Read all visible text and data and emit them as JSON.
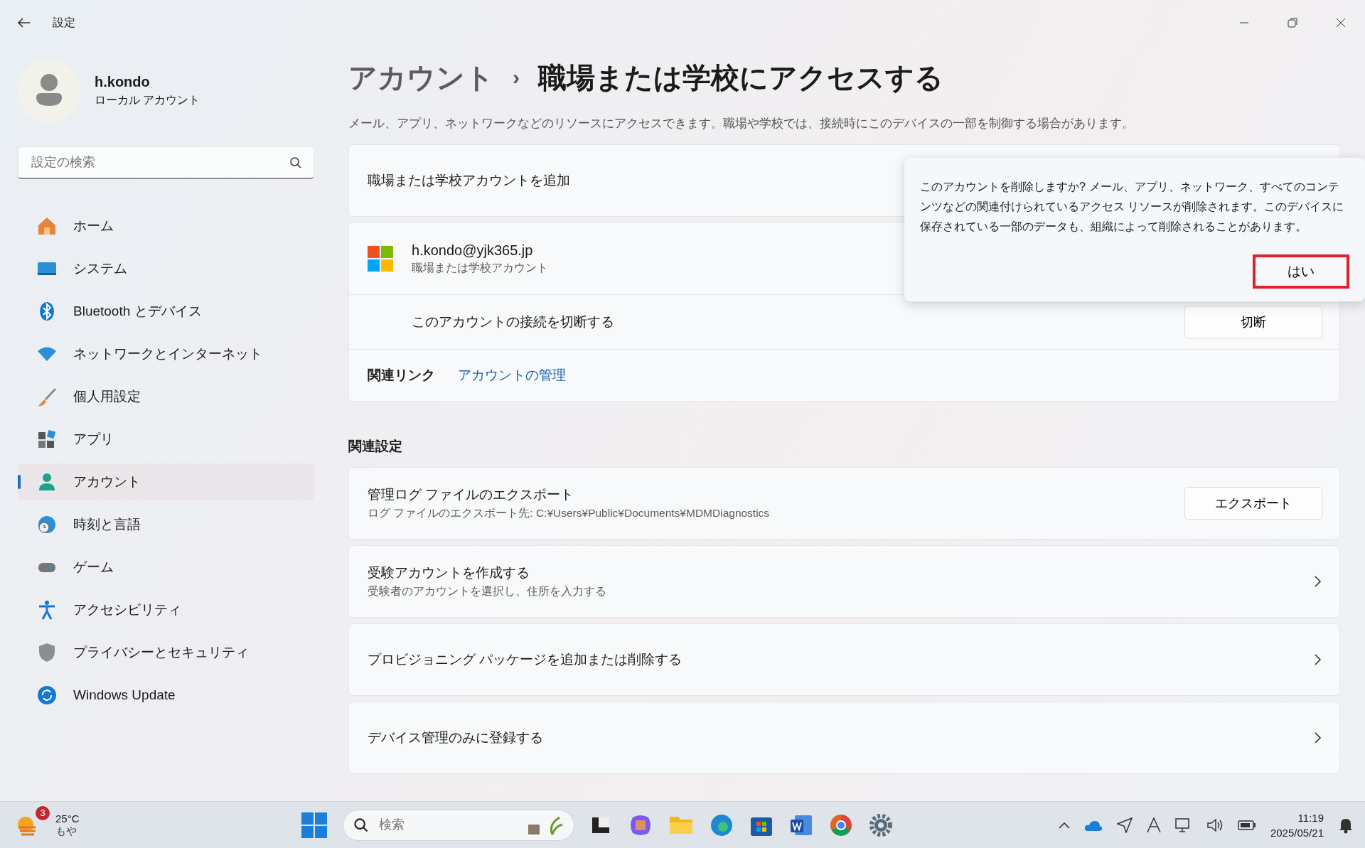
{
  "window": {
    "title": "設定"
  },
  "user": {
    "name": "h.kondo",
    "type": "ローカル アカウント"
  },
  "search": {
    "placeholder": "設定の検索"
  },
  "nav": [
    {
      "kind": "home",
      "label": "ホーム",
      "selected": false
    },
    {
      "kind": "system",
      "label": "システム",
      "selected": false
    },
    {
      "kind": "bluetooth",
      "label": "Bluetooth とデバイス",
      "selected": false
    },
    {
      "kind": "network",
      "label": "ネットワークとインターネット",
      "selected": false
    },
    {
      "kind": "personalize",
      "label": "個人用設定",
      "selected": false
    },
    {
      "kind": "apps",
      "label": "アプリ",
      "selected": false
    },
    {
      "kind": "account",
      "label": "アカウント",
      "selected": true
    },
    {
      "kind": "time",
      "label": "時刻と言語",
      "selected": false
    },
    {
      "kind": "game",
      "label": "ゲーム",
      "selected": false
    },
    {
      "kind": "accessibility",
      "label": "アクセシビリティ",
      "selected": false
    },
    {
      "kind": "privacy",
      "label": "プライバシーとセキュリティ",
      "selected": false
    },
    {
      "kind": "update",
      "label": "Windows Update",
      "selected": false
    }
  ],
  "breadcrumb": {
    "parent": "アカウント",
    "separator": "›",
    "current": "職場または学校にアクセスする"
  },
  "description": "メール、アプリ、ネットワークなどのリソースにアクセスできます。職場や学校では、接続時にこのデバイスの一部を制御する場合があります。",
  "add_account": {
    "label": "職場または学校アカウントを追加"
  },
  "account": {
    "email": "h.kondo@yjk365.jp",
    "type": "職場または学校アカウント",
    "disconnect_label": "このアカウントの接続を切断する",
    "disconnect_button": "切断",
    "related_links_label": "関連リンク",
    "manage_link": "アカウントの管理"
  },
  "related_settings": {
    "heading": "関連設定",
    "rows": [
      {
        "kind": "button",
        "title": "管理ログ ファイルのエクスポート",
        "subtitle": "ログ ファイルのエクスポート先: C:¥Users¥Public¥Documents¥MDMDiagnostics",
        "button": "エクスポート"
      },
      {
        "kind": "chevron",
        "title": "受験アカウントを作成する",
        "subtitle": "受験者のアカウントを選択し、住所を入力する"
      },
      {
        "kind": "chevron",
        "title": "プロビジョニング パッケージを追加または削除する"
      },
      {
        "kind": "chevron",
        "title": "デバイス管理のみに登録する"
      }
    ]
  },
  "popup": {
    "message": "このアカウントを削除しますか? メール、アプリ、ネットワーク、すべてのコンテンツなどの関連付けられているアクセス リソースが削除されます。このデバイスに保存されている一部のデータも、組織によって削除されることがあります。",
    "button": "はい",
    "highlighted": true
  },
  "taskbar": {
    "weather": {
      "badge": "3",
      "temperature": "25°C",
      "condition": "もや"
    },
    "search_placeholder": "検索",
    "time": "11:19",
    "date": "2025/05/21"
  }
}
